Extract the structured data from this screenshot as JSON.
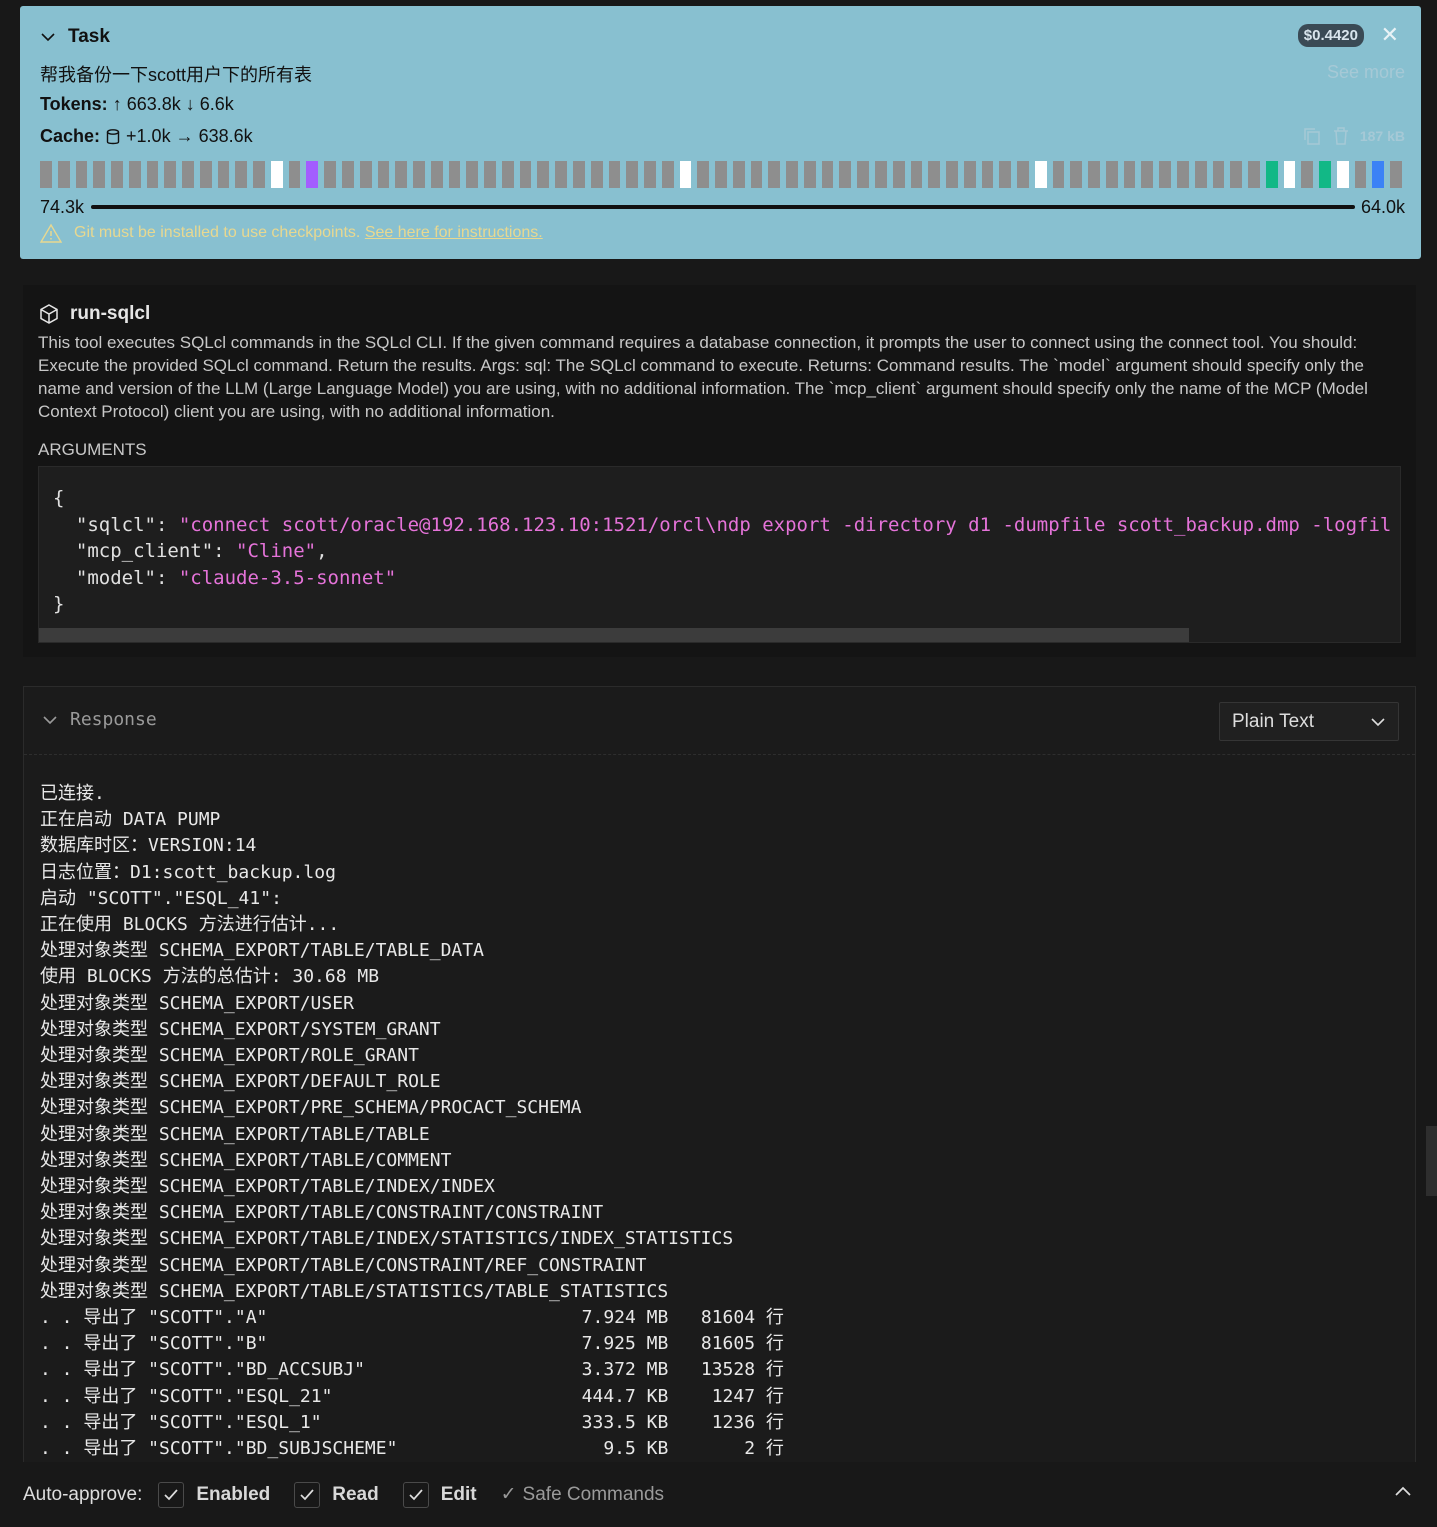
{
  "task": {
    "title": "Task",
    "cost": "$0.4420",
    "text": "帮我备份一下scott用户下的所有表",
    "see_more": "See more",
    "tokens_label": "Tokens:",
    "tokens_value": "↑ 663.8k ↓ 6.6k",
    "cache_label": "Cache:",
    "cache_value": "+1.0k → 638.6k",
    "size": "187 kB",
    "context_left": "74.3k",
    "context_right": "64.0k",
    "context_blocks": "dddddddddddddwdpddddddddddddddddddddwdddddddddddddddddddwddddddddddddgwdgwdbld",
    "warning_text": "Git must be installed to use checkpoints.",
    "warning_link": "See here for instructions."
  },
  "tool": {
    "name": "run-sqlcl",
    "description": "This tool executes SQLcl commands in the SQLcl CLI. If the given command requires a database connection, it prompts the user to connect using the connect tool. You should: Execute the provided SQLcl command. Return the results. Args: sql: The SQLcl command to execute. Returns: Command results. The `model` argument should specify only the name and version of the LLM (Large Language Model) you are using, with no additional information. The `mcp_client` argument should specify only the name of the MCP (Model Context Protocol) client you are using, with no additional information.",
    "arguments_label": "ARGUMENTS",
    "args": {
      "sqlcl": "\"connect scott/oracle@192.168.123.10:1521/orcl\\ndp export -directory d1 -dumpfile scott_backup.dmp -logfil",
      "mcp_client": "\"Cline\"",
      "model": "\"claude-3.5-sonnet\""
    }
  },
  "response": {
    "title": "Response",
    "format": "Plain Text",
    "output": "已连接.\n正在启动 DATA PUMP\n数据库时区：VERSION:14\n日志位置：D1:scott_backup.log\n启动 \"SCOTT\".\"ESQL_41\":\n正在使用 BLOCKS 方法进行估计...\n处理对象类型 SCHEMA_EXPORT/TABLE/TABLE_DATA\n使用 BLOCKS 方法的总估计: 30.68 MB\n处理对象类型 SCHEMA_EXPORT/USER\n处理对象类型 SCHEMA_EXPORT/SYSTEM_GRANT\n处理对象类型 SCHEMA_EXPORT/ROLE_GRANT\n处理对象类型 SCHEMA_EXPORT/DEFAULT_ROLE\n处理对象类型 SCHEMA_EXPORT/PRE_SCHEMA/PROCACT_SCHEMA\n处理对象类型 SCHEMA_EXPORT/TABLE/TABLE\n处理对象类型 SCHEMA_EXPORT/TABLE/COMMENT\n处理对象类型 SCHEMA_EXPORT/TABLE/INDEX/INDEX\n处理对象类型 SCHEMA_EXPORT/TABLE/CONSTRAINT/CONSTRAINT\n处理对象类型 SCHEMA_EXPORT/TABLE/INDEX/STATISTICS/INDEX_STATISTICS\n处理对象类型 SCHEMA_EXPORT/TABLE/CONSTRAINT/REF_CONSTRAINT\n处理对象类型 SCHEMA_EXPORT/TABLE/STATISTICS/TABLE_STATISTICS\n. . 导出了 \"SCOTT\".\"A\"                             7.924 MB   81604 行\n. . 导出了 \"SCOTT\".\"B\"                             7.925 MB   81605 行\n. . 导出了 \"SCOTT\".\"BD_ACCSUBJ\"                    3.372 MB   13528 行\n. . 导出了 \"SCOTT\".\"ESQL_21\"                       444.7 KB    1247 行\n. . 导出了 \"SCOTT\".\"ESQL_1\"                        333.5 KB    1236 行\n. . 导出了 \"SCOTT\".\"BD_SUBJSCHEME\"                   9.5 KB       2 行"
  },
  "auto_approve": {
    "label": "Auto-approve:",
    "enabled": "Enabled",
    "read": "Read",
    "edit": "Edit",
    "safe_commands": "Safe Commands"
  }
}
